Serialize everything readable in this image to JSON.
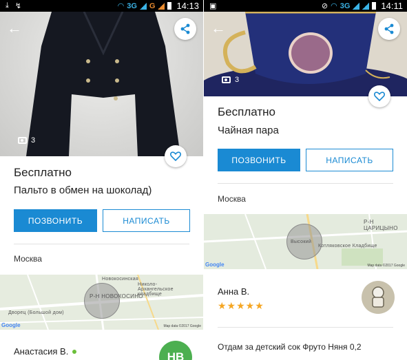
{
  "status_left": {
    "time": "14:13",
    "net_3g": "3G",
    "net_g": "G"
  },
  "status_right": {
    "time": "14:11",
    "net_3g": "3G"
  },
  "left": {
    "photo_count": "3",
    "price": "Бесплатно",
    "title": "Пальто в обмен на шоколад)",
    "call_label": "ПОЗВОНИТЬ",
    "write_label": "НАПИСАТЬ",
    "city": "Москва",
    "map": {
      "district": "Р-Н НОВОКОСИНО",
      "street": "Новокосинская",
      "cemetery": "Николо-Архангельское кладбище",
      "palace": "Дворец (Большой дом)",
      "attribution": "Map data ©2017 Google",
      "logo": "Google"
    },
    "seller_name": "Анастасия В.",
    "avatar_initials": "НВ",
    "avatar_color": "#4caf50"
  },
  "right": {
    "photo_count": "3",
    "price": "Бесплатно",
    "title": "Чайная пара",
    "call_label": "ПОЗВОНИТЬ",
    "write_label": "НАПИСАТЬ",
    "city": "Москва",
    "map": {
      "district": "Р-Н ЦАРИЦЫНО",
      "cemetery": "Котляковское Кладбище",
      "place": "Высокий",
      "attribution": "Map data ©2017 Google",
      "logo": "Google"
    },
    "seller_name": "Анна В.",
    "rating_stars": "★★★★★",
    "description": "Отдам за детский сок Фруто Няня 0,2"
  },
  "colors": {
    "accent": "#1a8ad3",
    "star": "#f5a623",
    "online": "#6bbf3a"
  }
}
